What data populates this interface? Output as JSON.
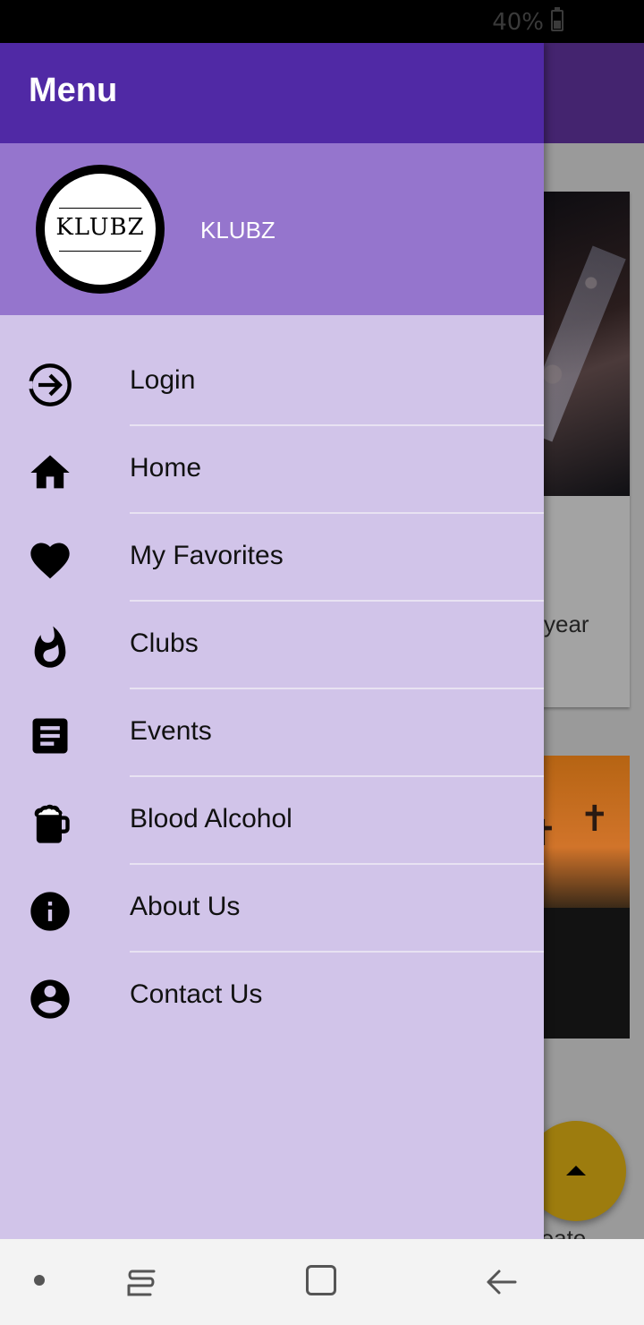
{
  "status_bar": {
    "battery_text": "40%"
  },
  "drawer": {
    "title": "Menu",
    "brand": {
      "logo_text": "KLUBZ",
      "name": "KLUBZ"
    },
    "items": [
      {
        "label": "Login",
        "icon": "login-icon"
      },
      {
        "label": "Home",
        "icon": "home-icon"
      },
      {
        "label": "My Favorites",
        "icon": "heart-icon"
      },
      {
        "label": "Clubs",
        "icon": "fire-icon"
      },
      {
        "label": "Events",
        "icon": "article-icon"
      },
      {
        "label": "Blood Alcohol",
        "icon": "beer-mug-icon"
      },
      {
        "label": "About Us",
        "icon": "info-icon"
      },
      {
        "label": "Contact Us",
        "icon": "account-circle-icon"
      }
    ]
  },
  "background": {
    "card1_text": "year",
    "below_text": "reate"
  },
  "colors": {
    "app_bar": "#5029a5",
    "drawer_header": "#9575cd",
    "drawer_bg": "#d1c4e9",
    "fab": "#9d7c0e"
  }
}
